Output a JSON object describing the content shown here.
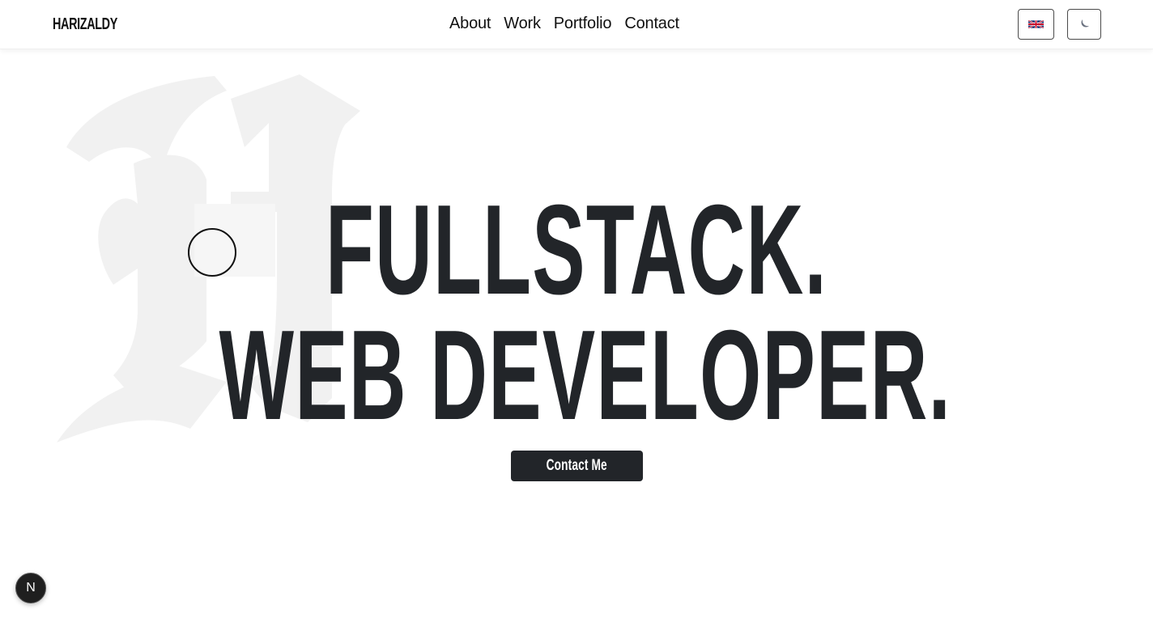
{
  "header": {
    "logo": "HARIZALDY",
    "nav": [
      "About",
      "Work",
      "Portfolio",
      "Contact"
    ],
    "language_icon": "uk-flag-icon",
    "theme_icon": "moon-icon"
  },
  "hero": {
    "watermark_letter": "H",
    "line1": "FULLSTACK.",
    "line2": "WEB DEVELOPER.",
    "cta_label": "Contact Me"
  },
  "badge": {
    "label": "N"
  },
  "colors": {
    "text": "#222529",
    "watermark": "#f1f1f1",
    "button_bg": "#222529"
  }
}
